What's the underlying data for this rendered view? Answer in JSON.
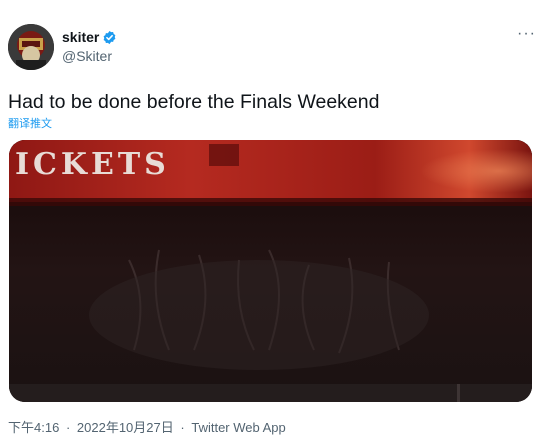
{
  "author": {
    "display_name": "skiter",
    "handle": "@Skiter",
    "verified_icon": "verified-badge-icon",
    "avatar_icon": "avatar-image"
  },
  "menu": {
    "more_label": "···"
  },
  "tweet": {
    "text": "Had to be done before the Finals Weekend",
    "translate_label": "翻译推文"
  },
  "media": {
    "visible_text": "ICKETS"
  },
  "footer": {
    "time": "下午4:16",
    "separator": "·",
    "date": "2022年10月27日",
    "source": "Twitter Web App"
  },
  "colors": {
    "link": "#1d9bf0",
    "secondary_text": "#536471",
    "primary_text": "#0f1419",
    "verified": "#1d9bf0",
    "banner_red": "#b8231c"
  }
}
